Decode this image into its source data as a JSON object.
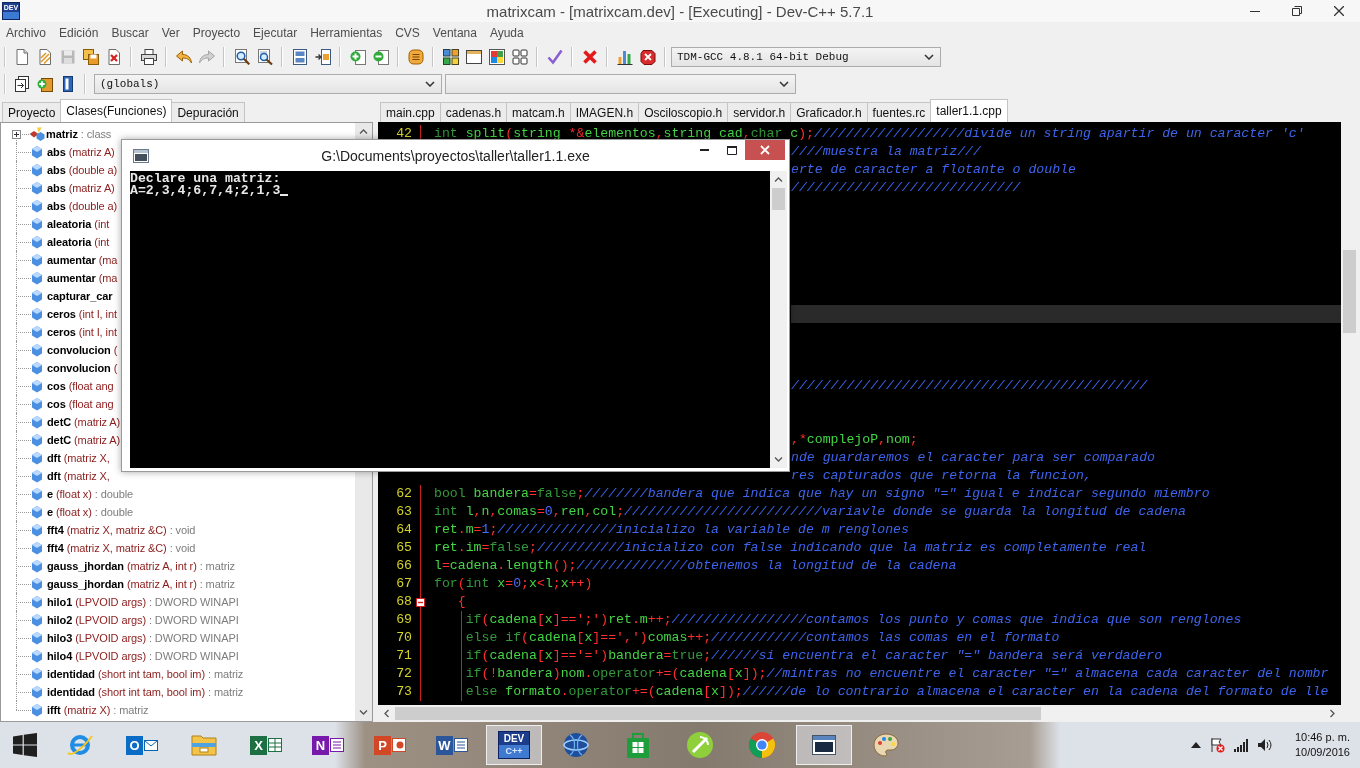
{
  "window": {
    "logo_text": "DEV",
    "title": "matrixcam - [matrixcam.dev] - [Executing] - Dev-C++ 5.7.1"
  },
  "menu": [
    "Archivo",
    "Edición",
    "Buscar",
    "Ver",
    "Proyecto",
    "Ejecutar",
    "Herramientas",
    "CVS",
    "Ventana",
    "Ayuda"
  ],
  "toolbar": [
    [
      {
        "kind": "new",
        "disabled": false
      },
      {
        "kind": "open",
        "disabled": false
      },
      {
        "kind": "save",
        "disabled": true
      },
      {
        "kind": "save_all",
        "disabled": false
      },
      {
        "kind": "close",
        "disabled": false
      }
    ],
    [
      {
        "kind": "print",
        "disabled": false
      }
    ],
    [
      {
        "kind": "undo",
        "disabled": false
      },
      {
        "kind": "redo",
        "disabled": true
      }
    ],
    [
      {
        "kind": "find",
        "disabled": false
      },
      {
        "kind": "replace",
        "disabled": false
      }
    ],
    [
      {
        "kind": "indent",
        "disabled": false
      },
      {
        "kind": "goto",
        "disabled": false
      }
    ],
    [
      {
        "kind": "add",
        "disabled": false
      },
      {
        "kind": "remove",
        "disabled": false
      }
    ],
    [
      {
        "kind": "options",
        "disabled": false
      }
    ],
    [
      {
        "kind": "compile",
        "disabled": false
      },
      {
        "kind": "run",
        "disabled": false
      },
      {
        "kind": "compile_run",
        "disabled": false
      },
      {
        "kind": "rebuild",
        "disabled": false
      }
    ],
    [
      {
        "kind": "check",
        "disabled": false
      }
    ],
    [
      {
        "kind": "stop",
        "disabled": false
      }
    ],
    [
      {
        "kind": "chart",
        "disabled": false
      },
      {
        "kind": "debug_stop",
        "disabled": false
      }
    ]
  ],
  "compiler_select": {
    "value": "TDM-GCC 4.8.1 64-bit Debug"
  },
  "toolbar2": [
    {
      "kind": "pages",
      "disabled": false
    },
    {
      "kind": "add_folder",
      "disabled": false
    },
    {
      "kind": "bookmark",
      "disabled": false
    }
  ],
  "scope_select": {
    "value": "(globals)"
  },
  "left_tabs": [
    {
      "label": "Proyecto",
      "selected": false
    },
    {
      "label": "Clases(Funciones)",
      "selected": true
    },
    {
      "label": "Depuración",
      "selected": false
    }
  ],
  "class_tree": [
    {
      "kind": "class",
      "name": "matriz",
      "type": ": class",
      "expanded": false
    },
    {
      "kind": "function",
      "name": "abs",
      "params": "(matriz A)"
    },
    {
      "kind": "function",
      "name": "abs",
      "params": "(double a)"
    },
    {
      "kind": "function",
      "name": "abs",
      "params": "(matriz A)"
    },
    {
      "kind": "function",
      "name": "abs",
      "params": "(double a)"
    },
    {
      "kind": "function",
      "name": "aleatoria",
      "params": "(int"
    },
    {
      "kind": "function",
      "name": "aleatoria",
      "params": "(int"
    },
    {
      "kind": "function",
      "name": "aumentar",
      "params": "(ma"
    },
    {
      "kind": "function",
      "name": "aumentar",
      "params": "(ma"
    },
    {
      "kind": "function",
      "name": "capturar_car"
    },
    {
      "kind": "function",
      "name": "ceros",
      "params": "(int I, int"
    },
    {
      "kind": "function",
      "name": "ceros",
      "params": "(int I, int"
    },
    {
      "kind": "function",
      "name": "convolucion",
      "params": "("
    },
    {
      "kind": "function",
      "name": "convolucion",
      "params": "("
    },
    {
      "kind": "function",
      "name": "cos",
      "params": "(float ang"
    },
    {
      "kind": "function",
      "name": "cos",
      "params": "(float ang"
    },
    {
      "kind": "function",
      "name": "detC",
      "params": "(matriz A)"
    },
    {
      "kind": "function",
      "name": "detC",
      "params": "(matriz A)"
    },
    {
      "kind": "function",
      "name": "dft",
      "params": "(matriz X,"
    },
    {
      "kind": "function",
      "name": "dft",
      "params": "(matriz X,"
    },
    {
      "kind": "function",
      "name": "e",
      "params": "(float x)",
      "type": ": double"
    },
    {
      "kind": "function",
      "name": "e",
      "params": "(float x)",
      "type": ": double"
    },
    {
      "kind": "function",
      "name": "fft4",
      "params": "(matriz X, matriz &C)",
      "type": ": void"
    },
    {
      "kind": "function",
      "name": "fft4",
      "params": "(matriz X, matriz &C)",
      "type": ": void"
    },
    {
      "kind": "function",
      "name": "gauss_jhordan",
      "params": "(matriz A, int r)",
      "type": ": matriz"
    },
    {
      "kind": "function",
      "name": "gauss_jhordan",
      "params": "(matriz A, int r)",
      "type": ": matriz"
    },
    {
      "kind": "function",
      "name": "hilo1",
      "params": "(LPVOID args)",
      "type": ": DWORD WINAPI"
    },
    {
      "kind": "function",
      "name": "hilo2",
      "params": "(LPVOID args)",
      "type": ": DWORD WINAPI"
    },
    {
      "kind": "function",
      "name": "hilo3",
      "params": "(LPVOID args)",
      "type": ": DWORD WINAPI"
    },
    {
      "kind": "function",
      "name": "hilo4",
      "params": "(LPVOID args)",
      "type": ": DWORD WINAPI"
    },
    {
      "kind": "function",
      "name": "identidad",
      "params": "(short int tam, bool im)",
      "type": ": matriz"
    },
    {
      "kind": "function",
      "name": "identidad",
      "params": "(short int tam, bool im)",
      "type": ": matriz"
    },
    {
      "kind": "function",
      "name": "ifft",
      "params": "(matriz X)",
      "type": ": matriz"
    }
  ],
  "editor_tabs": [
    {
      "label": "main.cpp",
      "selected": false
    },
    {
      "label": "cadenas.h",
      "selected": false
    },
    {
      "label": "matcam.h",
      "selected": false
    },
    {
      "label": "IMAGEN.h",
      "selected": false
    },
    {
      "label": "Osciloscopio.h",
      "selected": false
    },
    {
      "label": "servidor.h",
      "selected": false
    },
    {
      "label": "Graficador.h",
      "selected": false
    },
    {
      "label": "fuentes.rc",
      "selected": false
    },
    {
      "label": "taller1.1.cpp",
      "selected": true
    }
  ],
  "editor": {
    "lines": [
      {
        "kind": "line",
        "number": "42",
        "highlighted": false,
        "segments": [
          {
            "kind": "keyword",
            "text": "int"
          },
          {
            "kind": "code",
            "text": " split(string *&elementos,string cad,"
          },
          {
            "kind": "keyword",
            "text": "char"
          },
          {
            "kind": "code",
            "text": " c);"
          },
          {
            "kind": "comment",
            "text": "///////////////////divide un string apartir de un caracter 'c'"
          }
        ]
      },
      {
        "kind": "fragment",
        "highlighted": false,
        "segments": [
          {
            "kind": "comment",
            "text": "////muestra la matriz///"
          }
        ]
      },
      {
        "kind": "fragment",
        "highlighted": false,
        "segments": [
          {
            "kind": "comment",
            "text": "erte de caracter a flotante o double"
          }
        ]
      },
      {
        "kind": "fragment",
        "highlighted": false,
        "segments": [
          {
            "kind": "comment",
            "text": "/////////////////////////////"
          }
        ]
      },
      {
        "kind": "fragment",
        "highlighted": false
      },
      {
        "kind": "fragment",
        "highlighted": false
      },
      {
        "kind": "fragment",
        "highlighted": false
      },
      {
        "kind": "fragment",
        "highlighted": false
      },
      {
        "kind": "fragment",
        "highlighted": false
      },
      {
        "kind": "fragment",
        "highlighted": false
      },
      {
        "kind": "fragment",
        "highlighted": true
      },
      {
        "kind": "fragment",
        "highlighted": false
      },
      {
        "kind": "fragment",
        "highlighted": false
      },
      {
        "kind": "fragment",
        "highlighted": false
      },
      {
        "kind": "fragment",
        "highlighted": false,
        "segments": [
          {
            "kind": "comment",
            "text": "/////////////////////////////////////////////"
          }
        ]
      },
      {
        "kind": "fragment",
        "highlighted": false
      },
      {
        "kind": "fragment",
        "highlighted": false
      },
      {
        "kind": "fragment",
        "highlighted": false,
        "segments": [
          {
            "kind": "code",
            "text": ",*complejoP,nom;"
          }
        ]
      },
      {
        "kind": "fragment",
        "highlighted": false,
        "segments": [
          {
            "kind": "comment",
            "text": "nde guardaremos el caracter para ser comparado"
          }
        ]
      },
      {
        "kind": "fragment",
        "highlighted": false,
        "segments": [
          {
            "kind": "comment",
            "text": "res capturados que retorna la funcion,"
          }
        ]
      },
      {
        "kind": "line",
        "number": "62",
        "highlighted": false,
        "segments": [
          {
            "kind": "keyword",
            "text": "bool"
          },
          {
            "kind": "code",
            "text": " bandera="
          },
          {
            "kind": "keyword",
            "text": "false"
          },
          {
            "kind": "code",
            "text": ";"
          },
          {
            "kind": "comment",
            "text": "////////bandera que indica que hay un signo \"=\" igual e indicar segundo miembro"
          }
        ]
      },
      {
        "kind": "line",
        "number": "63",
        "highlighted": false,
        "segments": [
          {
            "kind": "keyword",
            "text": "int"
          },
          {
            "kind": "code",
            "text": " l,n,comas=0,ren,col;"
          },
          {
            "kind": "comment",
            "text": "/////////////////////////variavle donde se guarda la longitud de cadena"
          }
        ]
      },
      {
        "kind": "line",
        "number": "64",
        "highlighted": false,
        "segments": [
          {
            "kind": "code",
            "text": "ret.m=1;"
          },
          {
            "kind": "comment",
            "text": "///////////////inicializo la variable de m renglones"
          }
        ]
      },
      {
        "kind": "line",
        "number": "65",
        "highlighted": false,
        "segments": [
          {
            "kind": "code",
            "text": "ret.im="
          },
          {
            "kind": "keyword",
            "text": "false"
          },
          {
            "kind": "code",
            "text": ";"
          },
          {
            "kind": "comment",
            "text": "///////////inicializo con false indicando que la matriz es completamente real"
          }
        ]
      },
      {
        "kind": "line",
        "number": "66",
        "highlighted": false,
        "segments": [
          {
            "kind": "code",
            "text": "l=cadena.length();"
          },
          {
            "kind": "comment",
            "text": "//////////////obtenemos la longitud de la cadena"
          }
        ]
      },
      {
        "kind": "line",
        "number": "67",
        "highlighted": false,
        "segments": [
          {
            "kind": "keyword",
            "text": "for"
          },
          {
            "kind": "code",
            "text": "("
          },
          {
            "kind": "keyword",
            "text": "int"
          },
          {
            "kind": "code",
            "text": " x=0;x<l;x++)"
          }
        ]
      },
      {
        "kind": "fold",
        "number": "68",
        "highlighted": false,
        "segments": [
          {
            "kind": "code",
            "text": "   {"
          }
        ]
      },
      {
        "kind": "block",
        "number": "69",
        "highlighted": false,
        "segments": [
          {
            "kind": "keyword",
            "text": "    if"
          },
          {
            "kind": "code",
            "text": "(cadena[x]==';')ret.m++;"
          },
          {
            "kind": "comment",
            "text": "/////////////////contamos los punto y comas que indica que son renglones"
          }
        ]
      },
      {
        "kind": "block",
        "number": "70",
        "highlighted": false,
        "segments": [
          {
            "kind": "keyword",
            "text": "    else if"
          },
          {
            "kind": "code",
            "text": "(cadena[x]==',')comas++;"
          },
          {
            "kind": "comment",
            "text": "////////////contamos las comas en el formato"
          }
        ]
      },
      {
        "kind": "block",
        "number": "71",
        "highlighted": false,
        "segments": [
          {
            "kind": "keyword",
            "text": "    if"
          },
          {
            "kind": "code",
            "text": "(cadena[x]=='=')bandera="
          },
          {
            "kind": "keyword",
            "text": "true"
          },
          {
            "kind": "code",
            "text": ";"
          },
          {
            "kind": "comment",
            "text": "//////si encuentra el caracter \"=\" bandera será verdadero"
          }
        ]
      },
      {
        "kind": "block",
        "number": "72",
        "highlighted": false,
        "segments": [
          {
            "kind": "keyword",
            "text": "    if"
          },
          {
            "kind": "code",
            "text": "(!bandera)nom."
          },
          {
            "kind": "keyword",
            "text": "operator"
          },
          {
            "kind": "code",
            "text": "+=(cadena[x]);"
          },
          {
            "kind": "comment",
            "text": "//mintras no encuentre el caracter \"=\" almacena cada caracter del nombr"
          }
        ]
      },
      {
        "kind": "block",
        "number": "73",
        "highlighted": false,
        "segments": [
          {
            "kind": "keyword",
            "text": "    else"
          },
          {
            "kind": "code",
            "text": " formato."
          },
          {
            "kind": "keyword",
            "text": "operator"
          },
          {
            "kind": "code",
            "text": "+=(cadena[x]);"
          },
          {
            "kind": "comment",
            "text": "//////de lo contrario almacena el caracter en la cadena del formato de lle"
          }
        ]
      }
    ]
  },
  "console": {
    "title": "G:\\Documents\\proyectos\\taller\\taller1.1.exe",
    "lines": [
      "Declare una matriz:",
      "A=2,3,4;6,7,4;2,1,3"
    ]
  },
  "taskbar": {
    "apps": [
      {
        "kind": "ie",
        "running": false
      },
      {
        "kind": "outlook",
        "label": "O",
        "running": false
      },
      {
        "kind": "explorer",
        "running": false
      },
      {
        "kind": "excel",
        "label": "X",
        "running": false
      },
      {
        "kind": "onenote",
        "label": "N",
        "running": false
      },
      {
        "kind": "powerpoint",
        "label": "P",
        "running": false
      },
      {
        "kind": "word",
        "label": "W",
        "running": false
      },
      {
        "kind": "devcpp",
        "label": "DEV",
        "sublabel": "C++",
        "running": true
      },
      {
        "kind": "earth",
        "running": false
      },
      {
        "kind": "store",
        "running": false
      },
      {
        "kind": "circle_app",
        "running": false
      },
      {
        "kind": "chrome",
        "running": false
      },
      {
        "kind": "console",
        "running": true
      },
      {
        "kind": "paint",
        "running": false
      }
    ],
    "time": "10:46 p. m.",
    "date": "10/09/2016"
  }
}
